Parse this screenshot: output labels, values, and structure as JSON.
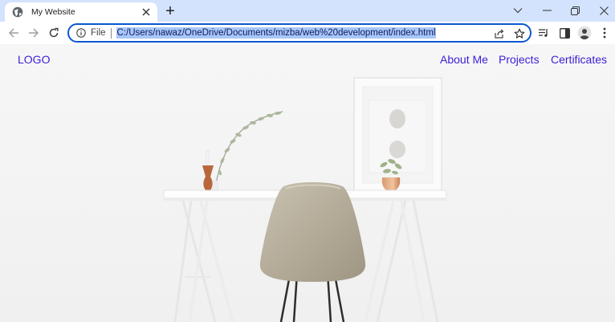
{
  "browser": {
    "tab_title": "My Website",
    "new_tab_label": "+",
    "address": {
      "scheme_label": "File",
      "url": "C:/Users/nawaz/OneDrive/Documents/mizba/web%20development/index.html"
    }
  },
  "site": {
    "logo": "LOGO",
    "nav": [
      {
        "label": "About Me"
      },
      {
        "label": "Projects"
      },
      {
        "label": "Certificates"
      }
    ]
  },
  "colors": {
    "accent": "#0b57d0",
    "tabstrip": "#d3e3fd",
    "link": "#3a1fd6",
    "url_highlight": "#a8c7fa"
  },
  "icons": [
    "globe-icon",
    "close-icon",
    "plus-icon",
    "chevron-down-icon",
    "minimize-icon",
    "restore-icon",
    "window-close-icon",
    "back-arrow-icon",
    "forward-arrow-icon",
    "reload-icon",
    "info-icon",
    "share-icon",
    "star-icon",
    "media-controls-icon",
    "side-panel-icon",
    "profile-avatar-icon",
    "kebab-menu-icon"
  ]
}
